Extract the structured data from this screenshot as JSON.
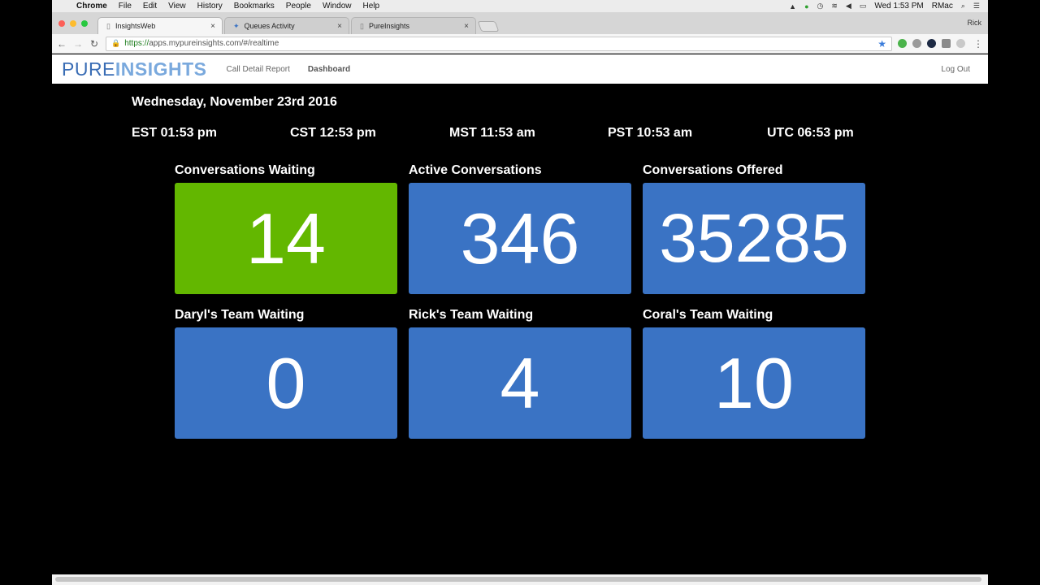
{
  "menubar": {
    "app": "Chrome",
    "items": [
      "File",
      "Edit",
      "View",
      "History",
      "Bookmarks",
      "People",
      "Window",
      "Help"
    ],
    "clock": "Wed 1:53 PM",
    "user": "RMac"
  },
  "browser": {
    "tabs": [
      {
        "label": "InsightsWeb",
        "icon": "page-icon"
      },
      {
        "label": "Queues Activity",
        "icon": "sparkle-icon"
      },
      {
        "label": "PureInsights",
        "icon": "page-icon"
      }
    ],
    "profile_name": "Rick",
    "url_scheme": "https://",
    "url_rest": "apps.mypureinsights.com/#/realtime"
  },
  "app": {
    "brand_part1": "PURE",
    "brand_part2": "INSIGHTS",
    "nav": [
      "Call Detail Report",
      "Dashboard"
    ],
    "logout": "Log Out",
    "colors": {
      "brand_dark": "#3a6db5",
      "brand_light": "#7aa9dd"
    }
  },
  "dashboard": {
    "date": "Wednesday, November 23rd 2016",
    "timezones": [
      "EST 01:53 pm",
      "CST 12:53 pm",
      "MST 11:53 am",
      "PST 10:53 am",
      "UTC 06:53 pm"
    ],
    "tiles": [
      {
        "title": "Conversations Waiting",
        "value": "14",
        "color": "#63b700"
      },
      {
        "title": "Active Conversations",
        "value": "346",
        "color": "#3a73c4"
      },
      {
        "title": "Conversations Offered",
        "value": "35285",
        "color": "#3a73c4"
      },
      {
        "title": "Daryl's Team Waiting",
        "value": "0",
        "color": "#3a73c4"
      },
      {
        "title": "Rick's Team Waiting",
        "value": "4",
        "color": "#3a73c4"
      },
      {
        "title": "Coral's Team Waiting",
        "value": "10",
        "color": "#3a73c4"
      }
    ]
  }
}
